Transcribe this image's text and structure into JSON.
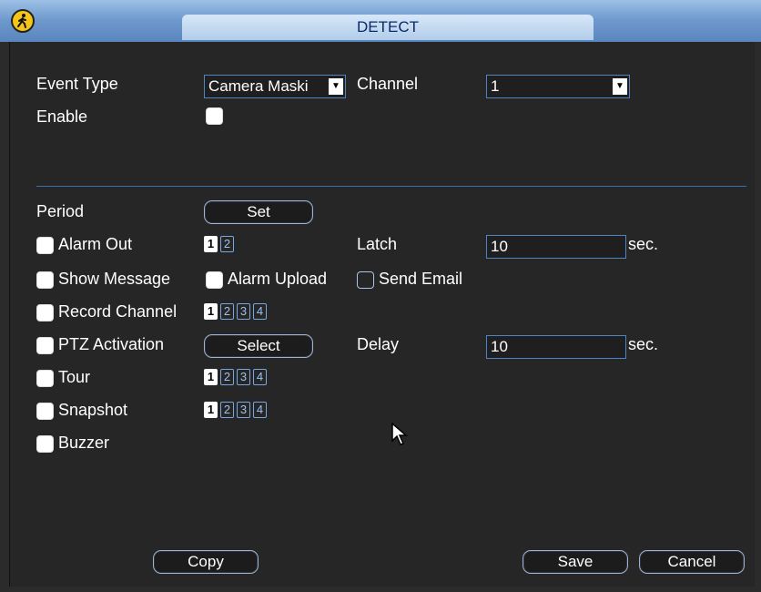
{
  "window": {
    "title": "DETECT",
    "icon": "walking-person-icon"
  },
  "event": {
    "event_type_label": "Event Type",
    "event_type_value": "Camera Maski",
    "channel_label": "Channel",
    "channel_value": "1",
    "enable_label": "Enable",
    "enable_checked": true
  },
  "period": {
    "label": "Period",
    "set_label": "Set"
  },
  "alarm_out": {
    "label": "Alarm Out",
    "channels": [
      "1",
      "2"
    ],
    "selected": [
      "1"
    ]
  },
  "latch": {
    "label": "Latch",
    "value": "10",
    "unit": "sec."
  },
  "show_message": {
    "label": "Show Message"
  },
  "alarm_upload": {
    "label": "Alarm Upload"
  },
  "send_email": {
    "label": "Send Email"
  },
  "record_channel": {
    "label": "Record Channel",
    "channels": [
      "1",
      "2",
      "3",
      "4"
    ],
    "selected": [
      "1"
    ]
  },
  "ptz": {
    "label": "PTZ Activation",
    "select_label": "Select"
  },
  "delay": {
    "label": "Delay",
    "value": "10",
    "unit": "sec."
  },
  "tour": {
    "label": "Tour",
    "channels": [
      "1",
      "2",
      "3",
      "4"
    ],
    "selected": [
      "1"
    ]
  },
  "snapshot": {
    "label": "Snapshot",
    "channels": [
      "1",
      "2",
      "3",
      "4"
    ],
    "selected": [
      "1"
    ]
  },
  "buzzer": {
    "label": "Buzzer"
  },
  "footer": {
    "copy_label": "Copy",
    "save_label": "Save",
    "cancel_label": "Cancel"
  }
}
